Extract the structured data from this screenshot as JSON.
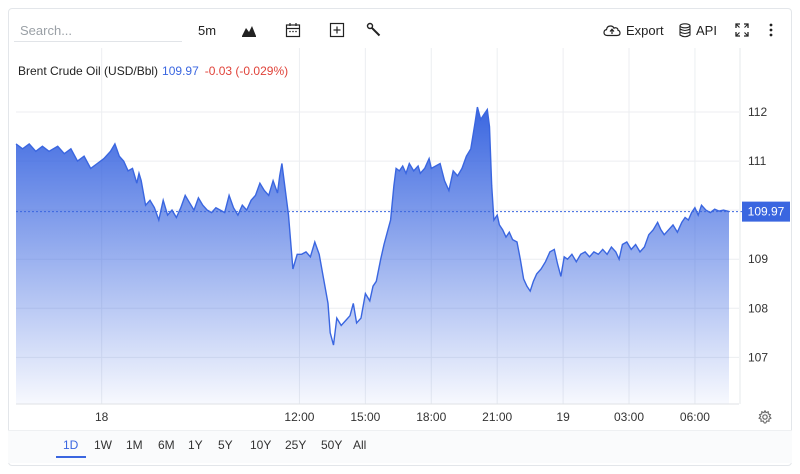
{
  "search": {
    "placeholder": "Search..."
  },
  "toolbar": {
    "interval_label": "5m",
    "export_label": "Export",
    "api_label": "API",
    "icons": [
      "chart-type-icon",
      "calendar-icon",
      "add-indicator-icon",
      "tools-icon",
      "cloud-export-icon",
      "database-icon",
      "fullscreen-icon",
      "more-icon"
    ]
  },
  "header": {
    "instrument": "Brent Crude Oil (USD/Bbl)",
    "price": "109.97",
    "change": "-0.03 (-0.029%)"
  },
  "range_buttons": [
    "1D",
    "1W",
    "1M",
    "6M",
    "1Y",
    "5Y",
    "10Y",
    "25Y",
    "50Y",
    "All"
  ],
  "active_range": "1D",
  "colors": {
    "line": "#3a66e0",
    "fill_top": "#3a66e0",
    "negative": "#e0433a",
    "grid": "#eceef1"
  },
  "chart_data": {
    "type": "area",
    "title": "Brent Crude Oil (USD/Bbl)",
    "xlabel": "",
    "ylabel": "",
    "x_tick_labels": [
      "18",
      "12:00",
      "15:00",
      "18:00",
      "21:00",
      "19",
      "03:00",
      "06:00"
    ],
    "x_tick_t": [
      3,
      12,
      15,
      18,
      21,
      24,
      27,
      30
    ],
    "y_ticks": [
      107,
      108,
      109,
      110,
      111,
      112
    ],
    "ylim": [
      106.05,
      112.55
    ],
    "xlim": [
      -0.9,
      31.55
    ],
    "last_price_label": "109.97",
    "grid": true,
    "x_unit": "hours from 18 00:00 — 24 = 19 00:00",
    "series": [
      {
        "name": "Brent Crude Oil",
        "points": [
          [
            -0.9,
            111.35
          ],
          [
            -0.6,
            111.25
          ],
          [
            -0.3,
            111.35
          ],
          [
            0.0,
            111.2
          ],
          [
            0.3,
            111.3
          ],
          [
            0.6,
            111.2
          ],
          [
            1.0,
            111.3
          ],
          [
            1.3,
            111.15
          ],
          [
            1.6,
            111.25
          ],
          [
            1.9,
            111.0
          ],
          [
            2.2,
            111.1
          ],
          [
            2.5,
            110.85
          ],
          [
            2.8,
            110.95
          ],
          [
            3.1,
            111.05
          ],
          [
            3.4,
            111.2
          ],
          [
            3.6,
            111.35
          ],
          [
            3.8,
            111.1
          ],
          [
            4.0,
            111.0
          ],
          [
            4.2,
            110.8
          ],
          [
            4.4,
            110.85
          ],
          [
            4.6,
            110.55
          ],
          [
            4.7,
            110.75
          ],
          [
            4.8,
            110.6
          ],
          [
            5.0,
            110.1
          ],
          [
            5.2,
            110.2
          ],
          [
            5.4,
            110.05
          ],
          [
            5.6,
            109.8
          ],
          [
            5.8,
            110.2
          ],
          [
            6.0,
            109.9
          ],
          [
            6.2,
            110.0
          ],
          [
            6.4,
            109.85
          ],
          [
            6.6,
            110.05
          ],
          [
            6.8,
            110.3
          ],
          [
            7.0,
            110.15
          ],
          [
            7.2,
            110.0
          ],
          [
            7.4,
            110.25
          ],
          [
            7.6,
            110.1
          ],
          [
            7.8,
            110.0
          ],
          [
            8.0,
            109.95
          ],
          [
            8.2,
            110.05
          ],
          [
            8.4,
            110.0
          ],
          [
            8.6,
            109.95
          ],
          [
            8.8,
            110.3
          ],
          [
            9.0,
            110.05
          ],
          [
            9.2,
            109.9
          ],
          [
            9.4,
            110.1
          ],
          [
            9.6,
            110.0
          ],
          [
            9.8,
            110.2
          ],
          [
            10.0,
            110.3
          ],
          [
            10.2,
            110.55
          ],
          [
            10.4,
            110.4
          ],
          [
            10.6,
            110.3
          ],
          [
            10.8,
            110.6
          ],
          [
            11.0,
            110.35
          ],
          [
            11.1,
            110.7
          ],
          [
            11.2,
            110.95
          ],
          [
            11.3,
            110.6
          ],
          [
            11.5,
            109.9
          ],
          [
            11.7,
            108.8
          ],
          [
            11.9,
            109.1
          ],
          [
            12.1,
            109.1
          ],
          [
            12.3,
            109.15
          ],
          [
            12.5,
            109.05
          ],
          [
            12.7,
            109.35
          ],
          [
            12.9,
            109.1
          ],
          [
            13.1,
            108.6
          ],
          [
            13.3,
            108.1
          ],
          [
            13.4,
            107.5
          ],
          [
            13.55,
            107.25
          ],
          [
            13.7,
            107.8
          ],
          [
            13.9,
            107.65
          ],
          [
            14.1,
            107.75
          ],
          [
            14.3,
            107.85
          ],
          [
            14.45,
            108.1
          ],
          [
            14.6,
            107.7
          ],
          [
            14.8,
            107.8
          ],
          [
            15.0,
            108.3
          ],
          [
            15.2,
            108.15
          ],
          [
            15.35,
            108.45
          ],
          [
            15.5,
            108.55
          ],
          [
            15.7,
            109.0
          ],
          [
            15.85,
            109.3
          ],
          [
            16.0,
            109.55
          ],
          [
            16.15,
            109.8
          ],
          [
            16.3,
            110.5
          ],
          [
            16.4,
            110.85
          ],
          [
            16.55,
            110.8
          ],
          [
            16.7,
            110.9
          ],
          [
            16.85,
            110.75
          ],
          [
            17.0,
            110.95
          ],
          [
            17.2,
            110.8
          ],
          [
            17.4,
            110.9
          ],
          [
            17.5,
            110.75
          ],
          [
            17.7,
            110.85
          ],
          [
            17.9,
            111.05
          ],
          [
            18.0,
            110.85
          ],
          [
            18.2,
            110.9
          ],
          [
            18.4,
            110.95
          ],
          [
            18.6,
            110.6
          ],
          [
            18.8,
            110.4
          ],
          [
            19.0,
            110.8
          ],
          [
            19.2,
            110.7
          ],
          [
            19.4,
            110.85
          ],
          [
            19.6,
            111.1
          ],
          [
            19.8,
            111.25
          ],
          [
            20.0,
            111.8
          ],
          [
            20.1,
            112.1
          ],
          [
            20.25,
            111.85
          ],
          [
            20.4,
            111.95
          ],
          [
            20.55,
            112.05
          ],
          [
            20.65,
            111.7
          ],
          [
            20.75,
            110.5
          ],
          [
            20.85,
            109.8
          ],
          [
            21.0,
            109.9
          ],
          [
            21.1,
            109.7
          ],
          [
            21.25,
            109.6
          ],
          [
            21.4,
            109.45
          ],
          [
            21.55,
            109.55
          ],
          [
            21.7,
            109.4
          ],
          [
            21.9,
            109.35
          ],
          [
            22.05,
            109.0
          ],
          [
            22.2,
            108.6
          ],
          [
            22.35,
            108.45
          ],
          [
            22.5,
            108.35
          ],
          [
            22.65,
            108.55
          ],
          [
            22.8,
            108.7
          ],
          [
            23.0,
            108.8
          ],
          [
            23.2,
            108.95
          ],
          [
            23.4,
            109.15
          ],
          [
            23.6,
            109.2
          ],
          [
            23.75,
            108.9
          ],
          [
            23.9,
            108.65
          ],
          [
            24.05,
            109.05
          ],
          [
            24.2,
            109.0
          ],
          [
            24.4,
            109.1
          ],
          [
            24.6,
            108.95
          ],
          [
            24.8,
            109.1
          ],
          [
            25.0,
            109.15
          ],
          [
            25.2,
            109.05
          ],
          [
            25.4,
            109.15
          ],
          [
            25.6,
            109.1
          ],
          [
            25.8,
            109.2
          ],
          [
            26.0,
            109.1
          ],
          [
            26.2,
            109.25
          ],
          [
            26.4,
            109.15
          ],
          [
            26.55,
            109.0
          ],
          [
            26.7,
            109.3
          ],
          [
            26.9,
            109.35
          ],
          [
            27.1,
            109.2
          ],
          [
            27.3,
            109.3
          ],
          [
            27.5,
            109.15
          ],
          [
            27.7,
            109.25
          ],
          [
            27.9,
            109.5
          ],
          [
            28.1,
            109.6
          ],
          [
            28.3,
            109.75
          ],
          [
            28.45,
            109.6
          ],
          [
            28.6,
            109.5
          ],
          [
            28.8,
            109.6
          ],
          [
            29.0,
            109.7
          ],
          [
            29.2,
            109.55
          ],
          [
            29.4,
            109.75
          ],
          [
            29.55,
            109.85
          ],
          [
            29.7,
            109.8
          ],
          [
            29.85,
            109.95
          ],
          [
            30.0,
            110.05
          ],
          [
            30.15,
            109.9
          ],
          [
            30.3,
            110.1
          ],
          [
            30.5,
            110.0
          ],
          [
            30.7,
            109.95
          ],
          [
            30.9,
            110.02
          ],
          [
            31.1,
            109.98
          ],
          [
            31.3,
            110.0
          ],
          [
            31.55,
            109.97
          ]
        ]
      }
    ]
  }
}
